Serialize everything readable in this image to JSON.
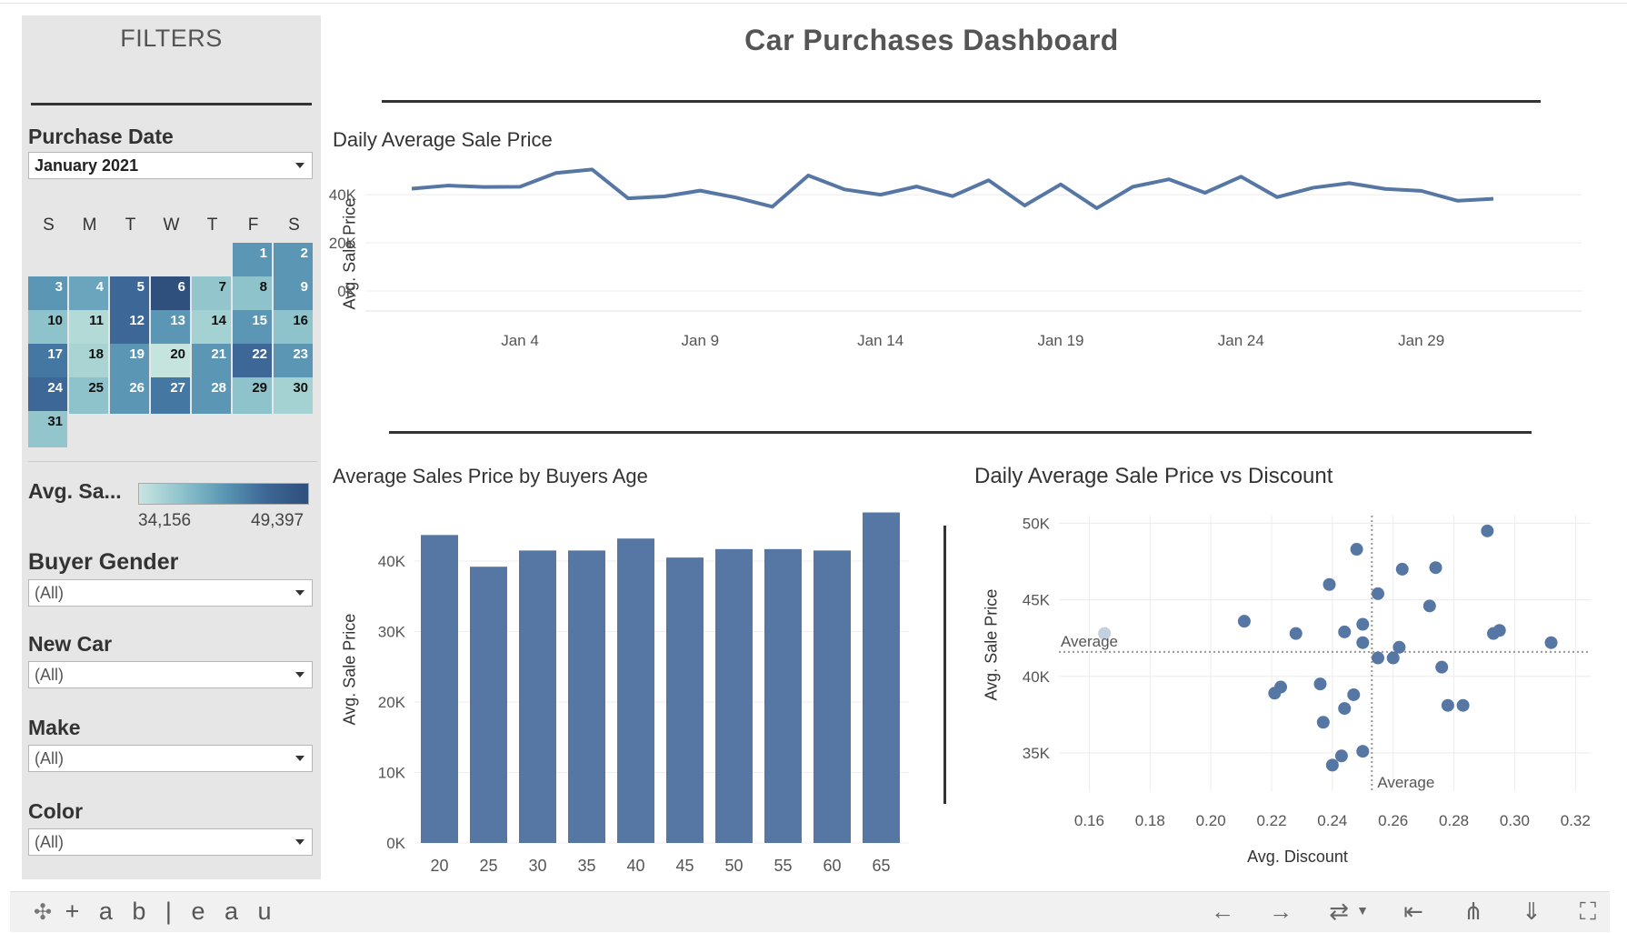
{
  "dashboard": {
    "title": "Car Purchases Dashboard"
  },
  "filters": {
    "title": "FILTERS",
    "purchase_date": {
      "label": "Purchase Date",
      "value": "January 2021"
    },
    "calendar": {
      "weekdays": [
        "S",
        "M",
        "T",
        "W",
        "T",
        "F",
        "S"
      ],
      "start_col": 5,
      "days": [
        {
          "d": "1",
          "c": "#5b97b4"
        },
        {
          "d": "2",
          "c": "#5b97b4"
        },
        {
          "d": "3",
          "c": "#5b97b4"
        },
        {
          "d": "4",
          "c": "#6aa4bd"
        },
        {
          "d": "5",
          "c": "#3d6796"
        },
        {
          "d": "6",
          "c": "#2f4f7c"
        },
        {
          "d": "7",
          "c": "#93c6cc"
        },
        {
          "d": "8",
          "c": "#8fc3cc"
        },
        {
          "d": "9",
          "c": "#5b97b4"
        },
        {
          "d": "10",
          "c": "#8fc3cc"
        },
        {
          "d": "11",
          "c": "#b3dad6"
        },
        {
          "d": "12",
          "c": "#3d6796"
        },
        {
          "d": "13",
          "c": "#5b97b4"
        },
        {
          "d": "14",
          "c": "#a4d1d1"
        },
        {
          "d": "15",
          "c": "#5b97b4"
        },
        {
          "d": "16",
          "c": "#8fc3cc"
        },
        {
          "d": "17",
          "c": "#4577a3"
        },
        {
          "d": "18",
          "c": "#a9d4d3"
        },
        {
          "d": "19",
          "c": "#5b97b4"
        },
        {
          "d": "20",
          "c": "#c6e4de"
        },
        {
          "d": "21",
          "c": "#5b97b4"
        },
        {
          "d": "22",
          "c": "#3d6796"
        },
        {
          "d": "23",
          "c": "#5b97b4"
        },
        {
          "d": "24",
          "c": "#3d6796"
        },
        {
          "d": "25",
          "c": "#8fc3cc"
        },
        {
          "d": "26",
          "c": "#5b97b4"
        },
        {
          "d": "27",
          "c": "#4577a3"
        },
        {
          "d": "28",
          "c": "#5b97b4"
        },
        {
          "d": "29",
          "c": "#8fc3cc"
        },
        {
          "d": "30",
          "c": "#a4d1d1"
        },
        {
          "d": "31",
          "c": "#93c6cc"
        }
      ]
    },
    "color_legend": {
      "label": "Avg. Sa...",
      "min": "34,156",
      "max": "49,397"
    },
    "buyer_gender": {
      "label": "Buyer Gender",
      "value": "(All)"
    },
    "new_car": {
      "label": "New Car",
      "value": "(All)"
    },
    "make": {
      "label": "Make",
      "value": "(All)"
    },
    "color": {
      "label": "Color",
      "value": "(All)"
    }
  },
  "toolbar": {
    "logo": "+ a b | e a u",
    "icons": [
      "undo-icon",
      "redo-icon",
      "revert-icon",
      "pause-icon",
      "share-icon",
      "download-icon",
      "fullscreen-icon"
    ]
  },
  "chart_data": [
    {
      "type": "line",
      "title": "Daily Average Sale Price",
      "ylabel": "Avg. Sale Price",
      "xlabel": "",
      "x": [
        "Jan 1",
        "Jan 2",
        "Jan 3",
        "Jan 4",
        "Jan 5",
        "Jan 6",
        "Jan 7",
        "Jan 8",
        "Jan 9",
        "Jan 10",
        "Jan 11",
        "Jan 12",
        "Jan 13",
        "Jan 14",
        "Jan 15",
        "Jan 16",
        "Jan 17",
        "Jan 18",
        "Jan 19",
        "Jan 20",
        "Jan 21",
        "Jan 22",
        "Jan 23",
        "Jan 24",
        "Jan 25",
        "Jan 26",
        "Jan 27",
        "Jan 28",
        "Jan 29",
        "Jan 30",
        "Jan 31"
      ],
      "values": [
        42500,
        43800,
        43200,
        43300,
        49000,
        50500,
        38500,
        39300,
        41700,
        38800,
        35000,
        48000,
        42200,
        40000,
        43400,
        39400,
        46000,
        35500,
        44300,
        34400,
        43300,
        46400,
        40800,
        47500,
        39000,
        42900,
        44800,
        42400,
        41600,
        37500,
        38300
      ],
      "xticks": [
        "Jan 4",
        "Jan 9",
        "Jan 14",
        "Jan 19",
        "Jan 24",
        "Jan 29"
      ],
      "yticks": [
        "0K",
        "20K",
        "40K"
      ],
      "ylim": [
        0,
        51000
      ],
      "color": "#5677a4"
    },
    {
      "type": "bar",
      "title": "Average Sales Price by Buyers Age",
      "ylabel": "Avg. Sale Price",
      "xlabel": "",
      "categories": [
        "20",
        "25",
        "30",
        "35",
        "40",
        "45",
        "50",
        "55",
        "60",
        "65"
      ],
      "values": [
        43700,
        39200,
        41500,
        41500,
        43200,
        40500,
        41700,
        41700,
        41500,
        46900
      ],
      "yticks": [
        "0K",
        "10K",
        "20K",
        "30K",
        "40K"
      ],
      "ylim": [
        0,
        48000
      ],
      "color": "#5677a4"
    },
    {
      "type": "scatter",
      "title": "Daily Average Sale Price vs Discount",
      "xlabel": "Avg. Discount",
      "ylabel": "Avg. Sale Price",
      "xlim": [
        0.15,
        0.325
      ],
      "ylim": [
        32500,
        50500
      ],
      "xticks": [
        "0.16",
        "0.18",
        "0.20",
        "0.22",
        "0.24",
        "0.26",
        "0.28",
        "0.30",
        "0.32"
      ],
      "yticks": [
        "35K",
        "40K",
        "45K",
        "50K"
      ],
      "avg_x": 0.253,
      "avg_y": 41600,
      "avg_label": "Average",
      "color": "#5677a4",
      "points": [
        {
          "x": 0.165,
          "y": 42800,
          "ghost": true
        },
        {
          "x": 0.291,
          "y": 49500
        },
        {
          "x": 0.248,
          "y": 48300
        },
        {
          "x": 0.274,
          "y": 47100
        },
        {
          "x": 0.263,
          "y": 47000
        },
        {
          "x": 0.239,
          "y": 46000
        },
        {
          "x": 0.255,
          "y": 45400
        },
        {
          "x": 0.272,
          "y": 44600
        },
        {
          "x": 0.211,
          "y": 43600
        },
        {
          "x": 0.25,
          "y": 43400
        },
        {
          "x": 0.228,
          "y": 42800
        },
        {
          "x": 0.244,
          "y": 42900
        },
        {
          "x": 0.293,
          "y": 42800
        },
        {
          "x": 0.295,
          "y": 43000
        },
        {
          "x": 0.312,
          "y": 42200
        },
        {
          "x": 0.25,
          "y": 42200
        },
        {
          "x": 0.262,
          "y": 41900
        },
        {
          "x": 0.255,
          "y": 41200
        },
        {
          "x": 0.26,
          "y": 41200
        },
        {
          "x": 0.276,
          "y": 40600
        },
        {
          "x": 0.223,
          "y": 39300
        },
        {
          "x": 0.221,
          "y": 38900
        },
        {
          "x": 0.236,
          "y": 39500
        },
        {
          "x": 0.247,
          "y": 38800
        },
        {
          "x": 0.244,
          "y": 37900
        },
        {
          "x": 0.278,
          "y": 38100
        },
        {
          "x": 0.283,
          "y": 38100
        },
        {
          "x": 0.237,
          "y": 37000
        },
        {
          "x": 0.25,
          "y": 35100
        },
        {
          "x": 0.243,
          "y": 34800
        },
        {
          "x": 0.24,
          "y": 34200
        }
      ]
    }
  ]
}
